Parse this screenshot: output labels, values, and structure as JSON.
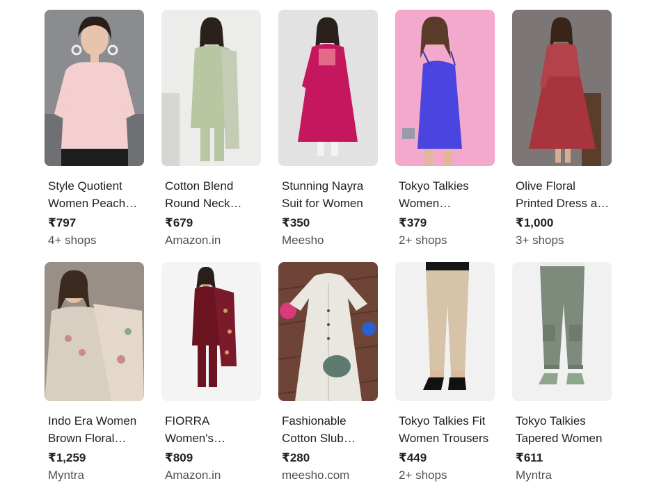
{
  "products": [
    {
      "title": "Style Quotient Women Peach Printed Top",
      "title_display": "Style Quotient Women Peach…",
      "price": "₹797",
      "seller": "4+ shops",
      "image": "model-pink-top"
    },
    {
      "title": "Cotton Blend Round Neck…",
      "title_display": "Cotton Blend Round Neck…",
      "price": "₹679",
      "seller": "Amazon.in",
      "image": "model-green-kurta-set"
    },
    {
      "title": "Stunning Nayra Suit for Women",
      "title_display": "Stunning Nayra Suit for Women",
      "price": "₹350",
      "seller": "Meesho",
      "image": "model-magenta-kurta"
    },
    {
      "title": "Tokyo Talkies Women…",
      "title_display": "Tokyo Talkies Women…",
      "price": "₹379",
      "seller": "2+ shops",
      "image": "model-blue-dress"
    },
    {
      "title": "Olive Floral Printed Dress a…",
      "title_display": "Olive Floral Printed Dress a…",
      "price": "₹1,000",
      "seller": "3+ shops",
      "image": "model-red-dress"
    },
    {
      "title": "Indo Era Women Brown Floral…",
      "title_display": "Indo Era Women Brown Floral…",
      "price": "₹1,259",
      "seller": "Myntra",
      "image": "model-floral-kurta"
    },
    {
      "title": "FIORRA Women's…",
      "title_display": "FIORRA Women's…",
      "price": "₹809",
      "seller": "Amazon.in",
      "image": "model-maroon-suit"
    },
    {
      "title": "Fashionable Cotton Slub…",
      "title_display": "Fashionable Cotton Slub…",
      "price": "₹280",
      "seller": "meesho.com",
      "image": "white-kurta-flatlay"
    },
    {
      "title": "Tokyo Talkies Fit Women Trousers",
      "title_display": "Tokyo Talkies Fit Women Trousers",
      "price": "₹449",
      "seller": "2+ shops",
      "image": "beige-trousers"
    },
    {
      "title": "Tokyo Talkies Tapered Women",
      "title_display": "Tokyo Talkies Tapered Women",
      "price": "₹611",
      "seller": "Myntra",
      "image": "green-cargo-trousers"
    }
  ]
}
